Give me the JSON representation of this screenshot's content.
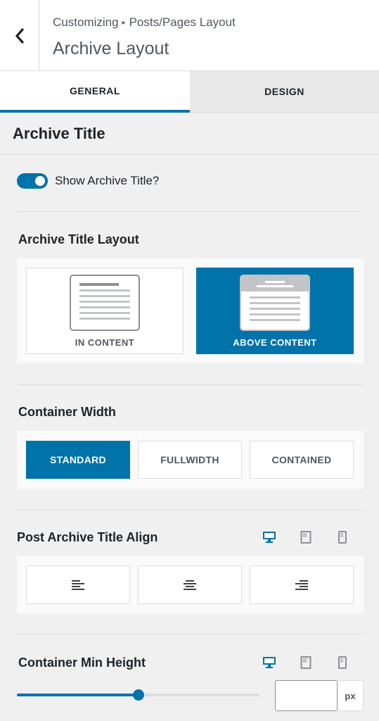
{
  "header": {
    "breadcrumb_root": "Customizing",
    "breadcrumb_sep": "▸",
    "breadcrumb_parent": "Posts/Pages Layout",
    "title": "Archive Layout"
  },
  "tabs": [
    {
      "label": "GENERAL",
      "active": true
    },
    {
      "label": "DESIGN",
      "active": false
    }
  ],
  "section": {
    "title": "Archive Title"
  },
  "show_title": {
    "label": "Show Archive Title?",
    "enabled": true
  },
  "title_layout": {
    "label": "Archive Title Layout",
    "options": [
      {
        "label": "IN CONTENT",
        "selected": false
      },
      {
        "label": "ABOVE CONTENT",
        "selected": true
      }
    ]
  },
  "container_width": {
    "label": "Container Width",
    "options": [
      {
        "label": "STANDARD",
        "selected": true
      },
      {
        "label": "FULLWIDTH",
        "selected": false
      },
      {
        "label": "CONTAINED",
        "selected": false
      }
    ]
  },
  "title_align": {
    "label": "Post Archive Title Align",
    "options": [
      "align-left-icon",
      "align-center-icon",
      "align-right-icon"
    ],
    "devices": [
      "desktop-icon",
      "tablet-icon",
      "mobile-icon"
    ],
    "active_device": "desktop"
  },
  "min_height": {
    "label": "Container Min Height",
    "slider_fraction": 0.5,
    "value": "",
    "unit": "px",
    "active_device": "desktop"
  },
  "colors": {
    "accent": "#0073aa",
    "border": "#dcdcde",
    "background": "#f0f0f1"
  }
}
